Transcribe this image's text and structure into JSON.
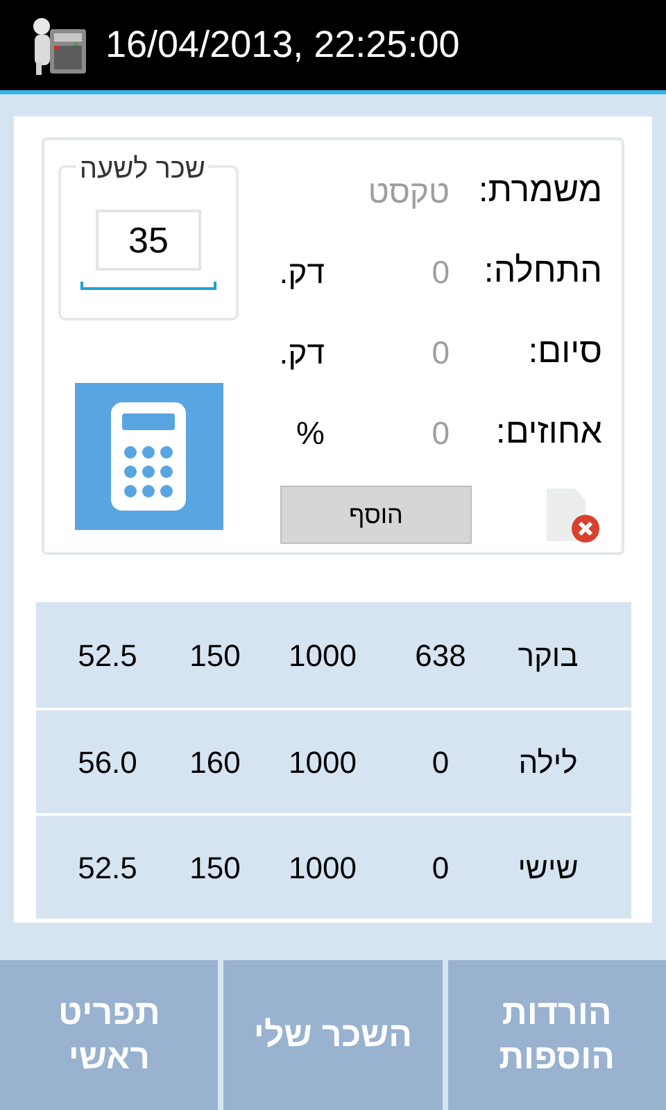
{
  "header": {
    "title": "16/04/2013, 22:25:00"
  },
  "form": {
    "fields": [
      {
        "label": "משמרת:",
        "placeholder": "טקסט"
      },
      {
        "label": "התחלה:",
        "placeholder": "0",
        "unit": "דק."
      },
      {
        "label": "סיום:",
        "placeholder": "0",
        "unit": "דק."
      },
      {
        "label": "אחוזים:",
        "placeholder": "0",
        "unit": "%"
      }
    ],
    "hourly_wage": {
      "legend": "שכר לשעה",
      "value": "35"
    },
    "add_button": "הוסף"
  },
  "table": {
    "rows": [
      [
        "בוקר",
        "638",
        "1000",
        "150",
        "52.5"
      ],
      [
        "לילה",
        "0",
        "1000",
        "160",
        "56.0"
      ],
      [
        "שישי",
        "0",
        "1000",
        "150",
        "52.5"
      ]
    ]
  },
  "bottom_nav": [
    "הורדות\nהוספות",
    "השכר שלי",
    "תפריט\nראשי"
  ]
}
